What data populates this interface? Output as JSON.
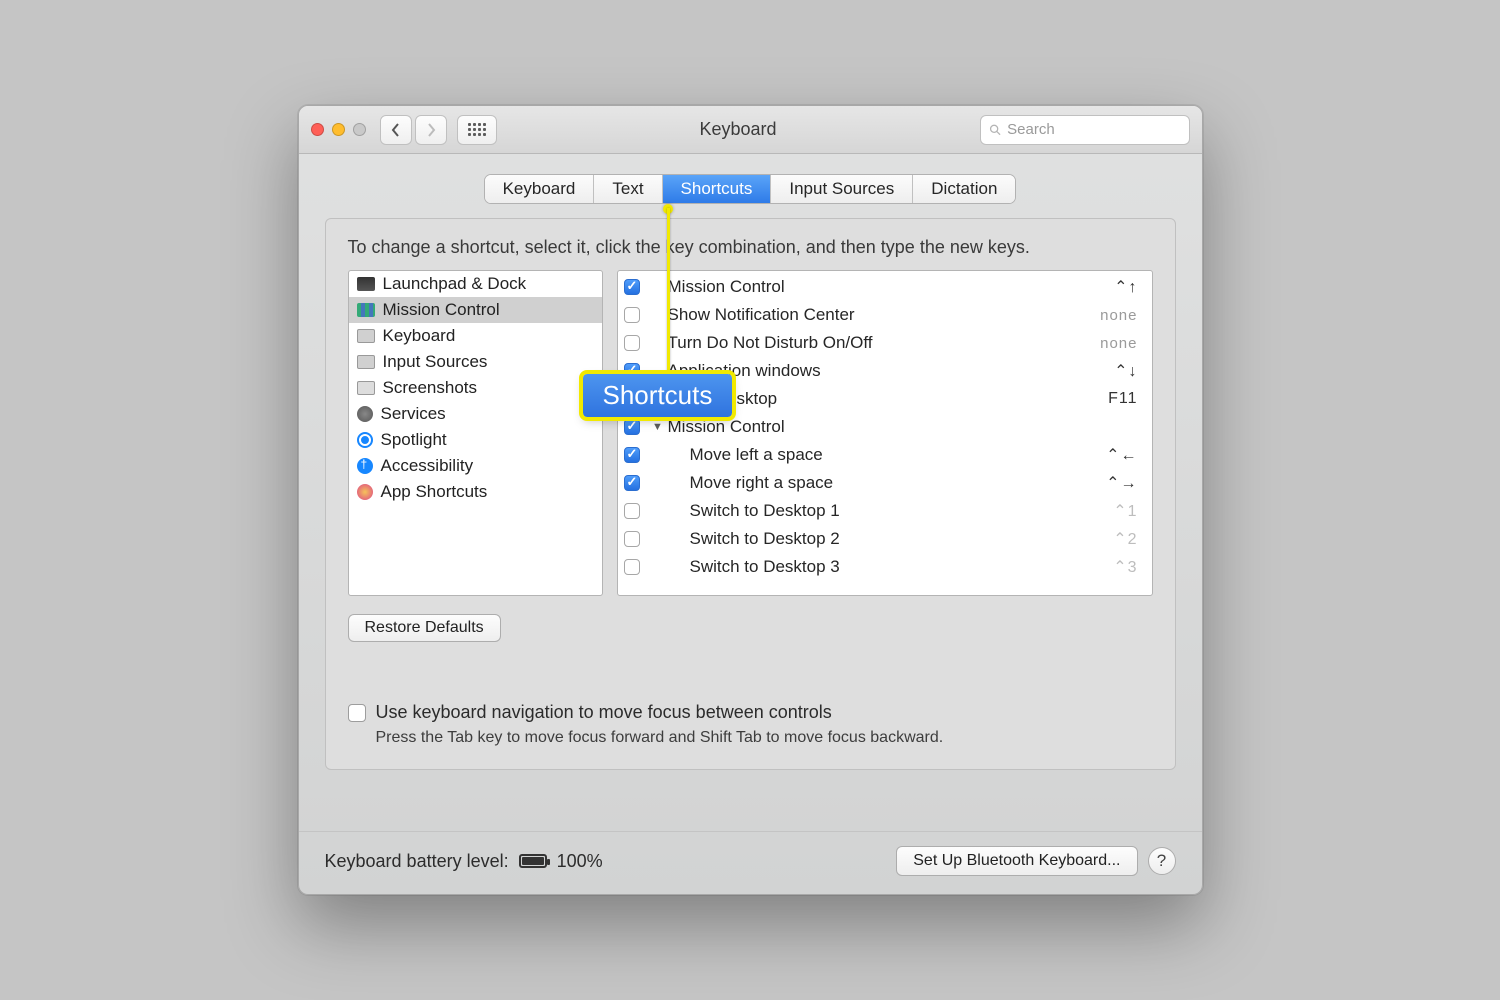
{
  "window": {
    "title": "Keyboard"
  },
  "search": {
    "placeholder": "Search"
  },
  "tabs": [
    {
      "label": "Keyboard"
    },
    {
      "label": "Text"
    },
    {
      "label": "Shortcuts"
    },
    {
      "label": "Input Sources"
    },
    {
      "label": "Dictation"
    }
  ],
  "active_tab_index": 2,
  "instruction": "To change a shortcut, select it, click the key combination, and then type the new keys.",
  "categories": [
    {
      "label": "Launchpad & Dock"
    },
    {
      "label": "Mission Control"
    },
    {
      "label": "Keyboard"
    },
    {
      "label": "Input Sources"
    },
    {
      "label": "Screenshots"
    },
    {
      "label": "Services"
    },
    {
      "label": "Spotlight"
    },
    {
      "label": "Accessibility"
    },
    {
      "label": "App Shortcuts"
    }
  ],
  "selected_category_index": 1,
  "shortcuts": [
    {
      "checked": true,
      "name": "Mission Control",
      "key": "⌃↑",
      "dim": false,
      "indent": 1
    },
    {
      "checked": false,
      "name": "Show Notification Center",
      "key": "none",
      "dim": false,
      "indent": 1
    },
    {
      "checked": false,
      "name": "Turn Do Not Disturb On/Off",
      "key": "none",
      "dim": false,
      "indent": 1
    },
    {
      "checked": true,
      "name": "Application windows",
      "key": "⌃↓",
      "dim": false,
      "indent": 1
    },
    {
      "checked": true,
      "name": "Show Desktop",
      "key": "F11",
      "dim": false,
      "indent": 1
    },
    {
      "checked": true,
      "name": "Mission Control",
      "key": "",
      "dim": false,
      "indent": 1,
      "group": true
    },
    {
      "checked": true,
      "name": "Move left a space",
      "key": "⌃←",
      "dim": false,
      "indent": 2
    },
    {
      "checked": true,
      "name": "Move right a space",
      "key": "⌃→",
      "dim": false,
      "indent": 2
    },
    {
      "checked": false,
      "name": "Switch to Desktop 1",
      "key": "⌃1",
      "dim": true,
      "indent": 2
    },
    {
      "checked": false,
      "name": "Switch to Desktop 2",
      "key": "⌃2",
      "dim": true,
      "indent": 2
    },
    {
      "checked": false,
      "name": "Switch to Desktop 3",
      "key": "⌃3",
      "dim": true,
      "indent": 2
    }
  ],
  "restore_button": "Restore Defaults",
  "kbnav": {
    "label": "Use keyboard navigation to move focus between controls",
    "sub": "Press the Tab key to move focus forward and Shift Tab to move focus backward."
  },
  "footer": {
    "battery_label": "Keyboard battery level:",
    "battery_pct": "100%",
    "bt_button": "Set Up Bluetooth Keyboard...",
    "help": "?"
  },
  "callout": {
    "text": "Shortcuts"
  }
}
